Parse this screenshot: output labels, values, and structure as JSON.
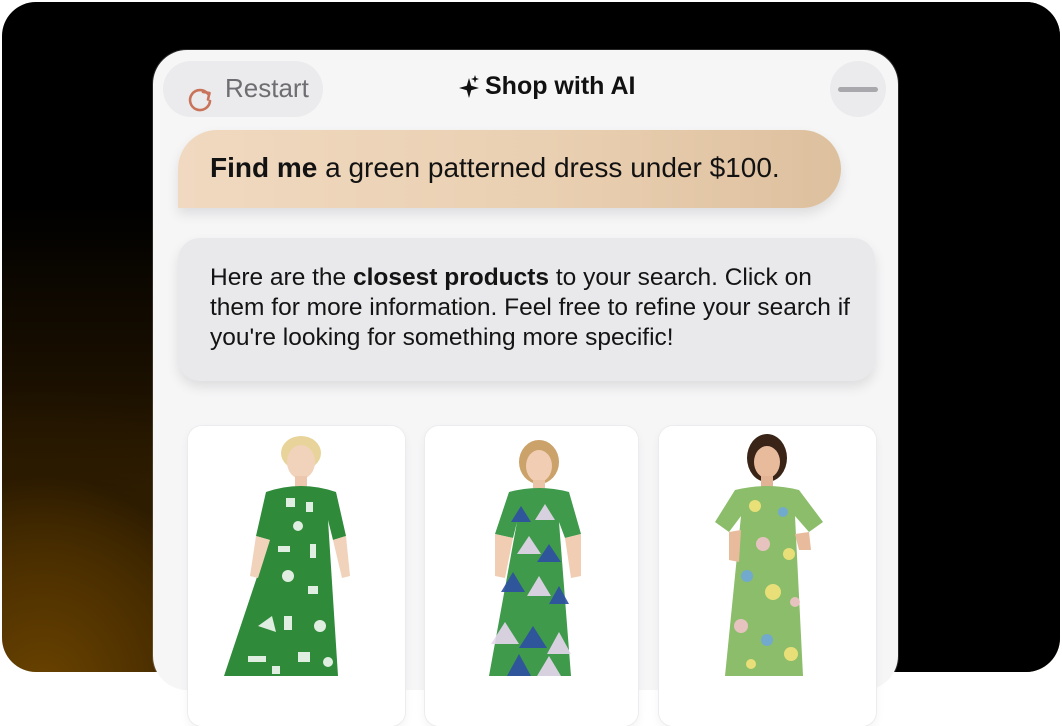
{
  "header": {
    "restart_label": "Restart",
    "title": "Shop with AI"
  },
  "conversation": {
    "user_message": {
      "bold": "Find me",
      "rest": " a green patterned dress under $100."
    },
    "ai_message": {
      "before": "Here are the ",
      "bold": "closest products",
      "after": " to your search. Click on them for more information. Feel free to refine your search if you're looking for something more specific!"
    }
  },
  "products": [
    {
      "image": "green-white-floral-maxi-dress",
      "pattern": "#2f8a3a"
    },
    {
      "image": "green-blue-triangle-print-dress",
      "pattern": "#3f9a4c"
    },
    {
      "image": "sage-floral-wrap-dress",
      "pattern": "#8bbd6a"
    }
  ],
  "colors": {
    "accent_restart_icon": "#c9735b",
    "user_bubble": "#ead0b2",
    "ai_bubble": "#e9e9ec"
  },
  "icons": {
    "restart": "refresh-icon",
    "title": "sparkle-icon",
    "minimize": "minus-icon"
  }
}
